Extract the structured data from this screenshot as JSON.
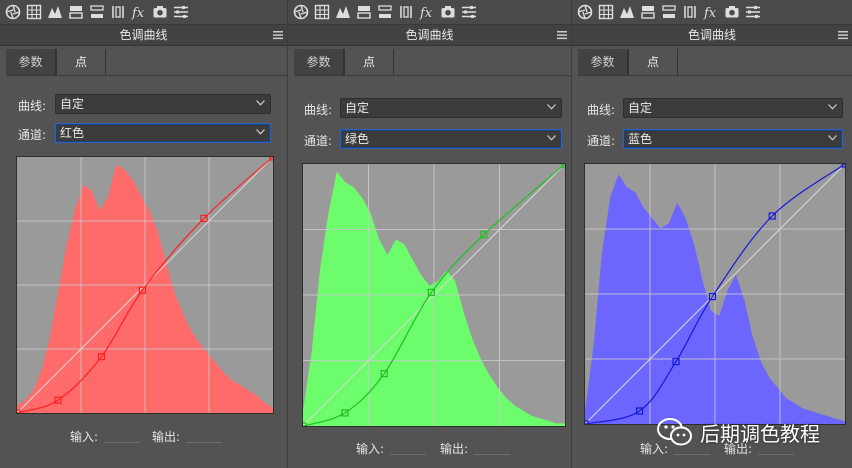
{
  "panel_title": "色调曲线",
  "tabs": {
    "params": "参数",
    "point": "点"
  },
  "labels": {
    "curve": "曲线:",
    "channel": "通道:",
    "input": "输入:",
    "output": "输出:"
  },
  "panels": [
    {
      "curve_value": "自定",
      "channel_value": "红色",
      "color": "#ff6a6a",
      "stroke": "#ff2020",
      "points": [
        [
          0,
          0
        ],
        [
          0.16,
          0.05
        ],
        [
          0.33,
          0.22
        ],
        [
          0.49,
          0.48
        ],
        [
          0.73,
          0.76
        ],
        [
          1,
          1
        ]
      ]
    },
    {
      "curve_value": "自定",
      "channel_value": "绿色",
      "color": "#6cfc6c",
      "stroke": "#20c020",
      "points": [
        [
          0,
          0
        ],
        [
          0.16,
          0.05
        ],
        [
          0.31,
          0.2
        ],
        [
          0.49,
          0.51
        ],
        [
          0.69,
          0.73
        ],
        [
          1,
          1
        ]
      ]
    },
    {
      "curve_value": "自定",
      "channel_value": "蓝色",
      "color": "#6c66ff",
      "stroke": "#1818d8",
      "points": [
        [
          0,
          0
        ],
        [
          0.21,
          0.05
        ],
        [
          0.35,
          0.24
        ],
        [
          0.49,
          0.49
        ],
        [
          0.72,
          0.8
        ],
        [
          1,
          1
        ]
      ]
    }
  ],
  "watermark": {
    "text": "后期调色教程"
  }
}
